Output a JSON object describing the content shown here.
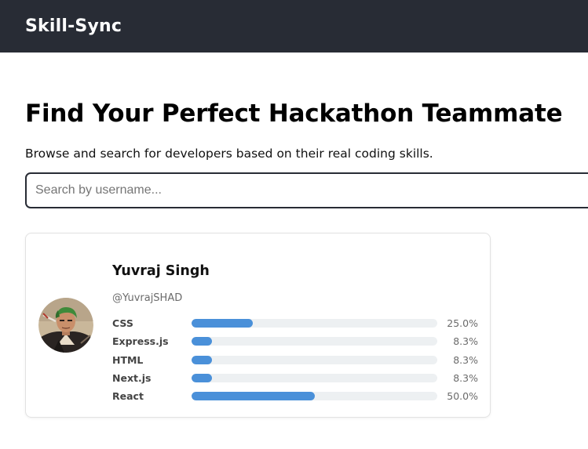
{
  "navbar": {
    "brand": "Skill-Sync"
  },
  "main": {
    "title": "Find Your Perfect Hackathon Teammate",
    "subtitle": "Browse and search for developers based on their real coding skills.",
    "search": {
      "placeholder": "Search by username...",
      "value": ""
    }
  },
  "cards": [
    {
      "name": "Yuvraj Singh",
      "username": "@YuvrajSHAD",
      "avatar_icon": "user-avatar-photo",
      "skills": [
        {
          "label": "CSS",
          "percent": 25.0,
          "percent_text": "25.0%"
        },
        {
          "label": "Express.js",
          "percent": 8.3,
          "percent_text": "8.3%"
        },
        {
          "label": "HTML",
          "percent": 8.3,
          "percent_text": "8.3%"
        },
        {
          "label": "Next.js",
          "percent": 8.3,
          "percent_text": "8.3%"
        },
        {
          "label": "React",
          "percent": 50.0,
          "percent_text": "50.0%"
        }
      ]
    }
  ],
  "colors": {
    "navbar_bg": "#282c35",
    "bar_fill": "#4a90d9",
    "bar_track": "#edf0f2"
  }
}
